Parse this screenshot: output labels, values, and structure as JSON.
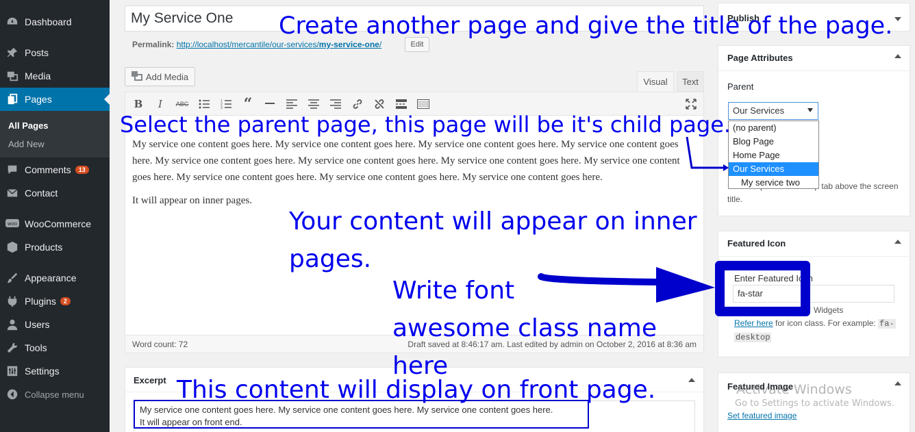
{
  "sidebar": {
    "items": [
      {
        "label": "Dashboard",
        "icon": "dashboard-icon"
      },
      {
        "label": "Posts",
        "icon": "pin-icon"
      },
      {
        "label": "Media",
        "icon": "media-icon"
      },
      {
        "label": "Pages",
        "icon": "pages-icon"
      },
      {
        "label": "Comments",
        "icon": "comment-icon",
        "badge": "13"
      },
      {
        "label": "Contact",
        "icon": "mail-icon"
      },
      {
        "label": "WooCommerce",
        "icon": "woo-icon"
      },
      {
        "label": "Products",
        "icon": "box-icon"
      },
      {
        "label": "Appearance",
        "icon": "brush-icon"
      },
      {
        "label": "Plugins",
        "icon": "plug-icon",
        "badge": "2"
      },
      {
        "label": "Users",
        "icon": "user-icon"
      },
      {
        "label": "Tools",
        "icon": "wrench-icon"
      },
      {
        "label": "Settings",
        "icon": "settings-icon"
      },
      {
        "label": "Collapse menu",
        "icon": "collapse-icon"
      }
    ],
    "submenu": [
      "All Pages",
      "Add New"
    ]
  },
  "editor": {
    "title": "My Service One",
    "permalink_label": "Permalink:",
    "permalink_base": "http://localhost/mercantile/our-services/",
    "permalink_slug": "my-service-one",
    "permalink_end": "/",
    "edit_label": "Edit",
    "add_media_label": "Add Media",
    "tab_visual": "Visual",
    "tab_text": "Text",
    "content_p1": "My service one content goes here. My service one content goes here.  My service one content goes here.  My service one content goes here. My service one content goes here. My service one content goes here. My service one content goes here. My service one content goes here. My service one content goes here. My service one content goes here. My service one content goes here.",
    "content_p2": "It will appear on inner pages.",
    "word_count": "Word count: 72",
    "draft_status": "Draft saved at 8:46:17 am. Last edited by admin on October 2, 2016 at 8:36 am"
  },
  "excerpt": {
    "title": "Excerpt",
    "line1": "My service one content goes here.  My service one content goes here. My service one content goes here.",
    "line2": "It will appear on front end."
  },
  "publish": {
    "title": "Publish"
  },
  "page_attributes": {
    "title": "Page Attributes",
    "parent_label": "Parent",
    "selected": "Our Services",
    "options": [
      "(no parent)",
      "Blog Page",
      "Home Page",
      "Our Services",
      "My service two"
    ],
    "help_text": "Need help? Use the Help tab above the screen title."
  },
  "featured_icon": {
    "title": "Featured Icon",
    "label": "Enter Featured Icon",
    "value": "fa-star",
    "help_widgets": "Widgets",
    "help_link": "Refer here",
    "help_mid": " for icon class. For example: ",
    "help_code1": "fa-",
    "help_code2": "desktop"
  },
  "featured_image": {
    "title": "Featured Image",
    "link": "Set featured image"
  },
  "watermark": {
    "title": "Activate Windows",
    "sub": "Go to Settings to activate Windows."
  },
  "annotations": {
    "title_note": "Create another page and give the title of the page.",
    "parent_note": "Select the parent page, this page will be it's child page.",
    "inner_note": "Your content will appear on inner pages.",
    "font_note_1": "Write font",
    "font_note_2": "awesome class name here",
    "front_note": "This content will display on front page."
  }
}
